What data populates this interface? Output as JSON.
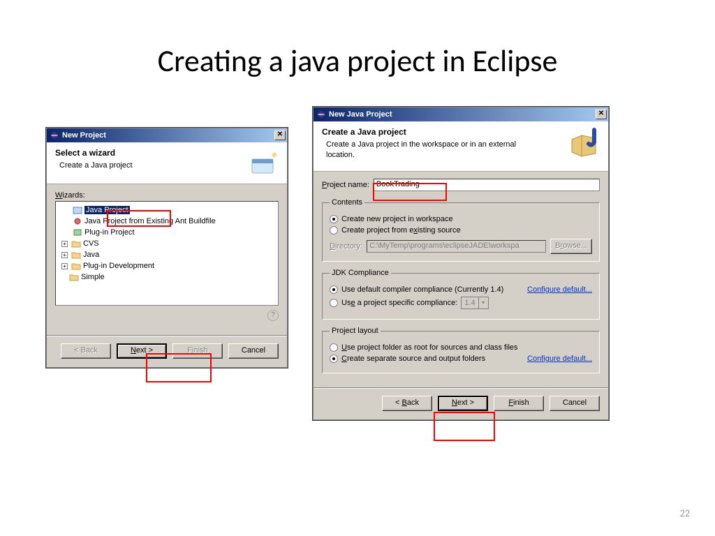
{
  "slide": {
    "title": "Creating a java project in Eclipse",
    "page": "22"
  },
  "dlg1": {
    "title": "New Project",
    "banner_title": "Select a wizard",
    "banner_sub": "Create a Java project",
    "wizards_label": "Wizards:",
    "tree": {
      "java_project": "Java Project",
      "ant": "Java Project from Existing Ant Buildfile",
      "plugin": "Plug-in Project",
      "cvs": "CVS",
      "java": "Java",
      "plugindev": "Plug-in Development",
      "simple": "Simple"
    },
    "buttons": {
      "back": "< Back",
      "next": "Next >",
      "finish": "Finish",
      "cancel": "Cancel"
    }
  },
  "dlg2": {
    "title": "New Java Project",
    "banner_title": "Create a Java project",
    "banner_sub": "Create a Java project in the workspace or in an external location.",
    "project_name_label": "Project name:",
    "project_name_value": "BookTrading",
    "contents": {
      "legend": "Contents",
      "opt_workspace": "Create new project in workspace",
      "opt_existing": "Create project from existing source",
      "directory_label": "Directory:",
      "directory_value": "C:\\MyTemp\\programs\\eclipseJADE\\workspa",
      "browse": "Browse..."
    },
    "jdk": {
      "legend": "JDK Compliance",
      "opt_default": "Use default compiler compliance (Currently 1.4)",
      "configure": "Configure default...",
      "opt_specific": "Use a project specific compliance:",
      "level": "1.4"
    },
    "layout": {
      "legend": "Project layout",
      "opt_root": "Use project folder as root for sources and class files",
      "opt_sep": "Create separate source and output folders",
      "configure": "Configure default..."
    },
    "buttons": {
      "back": "< Back",
      "next": "Next >",
      "finish": "Finish",
      "cancel": "Cancel"
    }
  }
}
